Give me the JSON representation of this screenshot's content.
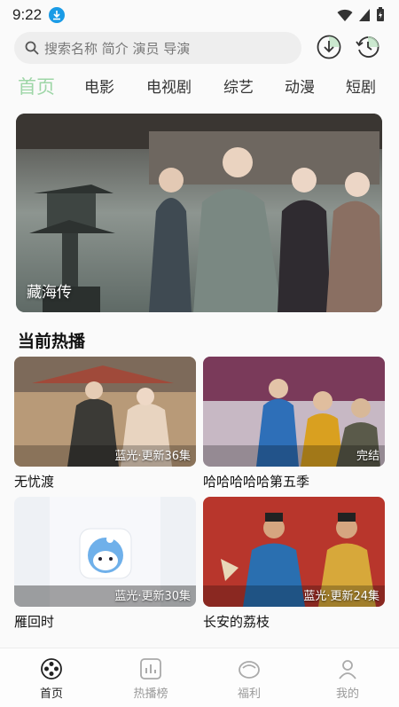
{
  "status_bar": {
    "time": "9:22"
  },
  "search": {
    "placeholder": "搜索名称 简介 演员 导演"
  },
  "tabs": [
    {
      "label": "首页",
      "active": true
    },
    {
      "label": "电影",
      "active": false
    },
    {
      "label": "电视剧",
      "active": false
    },
    {
      "label": "综艺",
      "active": false
    },
    {
      "label": "动漫",
      "active": false
    },
    {
      "label": "短剧",
      "active": false
    }
  ],
  "banner": {
    "title": "藏海传"
  },
  "sections": {
    "now_playing": "当前热播"
  },
  "cards": [
    {
      "title": "无忧渡",
      "badge": "蓝光·更新36集"
    },
    {
      "title": "哈哈哈哈哈第五季",
      "badge": "完结"
    },
    {
      "title": "雁回时",
      "badge": "蓝光·更新30集"
    },
    {
      "title": "长安的荔枝",
      "badge": "蓝光·更新24集"
    }
  ],
  "bottom_nav": [
    {
      "label": "首页",
      "icon": "film-reel-icon",
      "active": true
    },
    {
      "label": "热播榜",
      "icon": "chart-icon",
      "active": false
    },
    {
      "label": "福利",
      "icon": "gift-icon",
      "active": false
    },
    {
      "label": "我的",
      "icon": "user-icon",
      "active": false
    }
  ],
  "colors": {
    "accent": "#9ed6a7",
    "badge_blue": "#1a9be6",
    "search_bg": "#eeeeee"
  }
}
